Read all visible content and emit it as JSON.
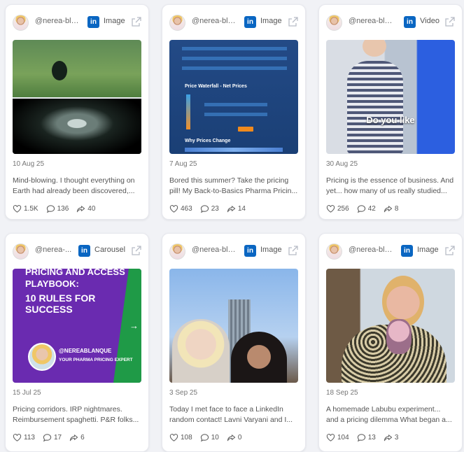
{
  "posts": [
    {
      "handle": "@nerea-bla...",
      "network": "in",
      "type": "Image",
      "date": "10 Aug 25",
      "desc1": "Mind-blowing. I thought everything on",
      "desc2": "Earth had already been discovered,...",
      "likes": "1.5K",
      "comments": "136",
      "shares": "40"
    },
    {
      "handle": "@nerea-bla...",
      "network": "in",
      "type": "Image",
      "date": "7 Aug 25",
      "desc1": "Bored this summer? Take the pricing",
      "desc2": "pill! My Back-to-Basics Pharma Pricin...",
      "likes": "463",
      "comments": "23",
      "shares": "14",
      "media_text": [
        "Price Waterfall - Net Prices",
        "Why Prices Change"
      ]
    },
    {
      "handle": "@nerea-bla...",
      "network": "in",
      "type": "Video",
      "date": "30 Aug 25",
      "desc1": "Pricing is the essence of business. And",
      "desc2": "yet... how many of us really studied...",
      "likes": "256",
      "comments": "42",
      "shares": "8",
      "media_text": [
        "Do you like"
      ]
    },
    {
      "handle": "@nerea-...",
      "network": "in",
      "type": "Carousel",
      "date": "15 Jul 25",
      "desc1": "Pricing corridors. IRP nightmares.",
      "desc2": "Reimbursement spaghetti. P&R folks...",
      "likes": "113",
      "comments": "17",
      "shares": "6",
      "media_text": [
        "PRICING AND ACCESS",
        "PLAYBOOK:",
        "10 RULES FOR SUCCESS",
        "@NEREABLANQUE",
        "YOUR PHARMA PRICING EXPERT"
      ]
    },
    {
      "handle": "@nerea-bla...",
      "network": "in",
      "type": "Image",
      "date": "3 Sep 25",
      "desc1": "Today I met face to face a LinkedIn",
      "desc2": "random contact! Lavni Varyani and I...",
      "likes": "108",
      "comments": "10",
      "shares": "0"
    },
    {
      "handle": "@nerea-bla...",
      "network": "in",
      "type": "Image",
      "date": "18 Sep 25",
      "desc1": "A homemade Labubu experiment...",
      "desc2": "and a pricing dilemma What began a...",
      "likes": "104",
      "comments": "13",
      "shares": "3"
    }
  ],
  "icons": {
    "network": "linkedin-icon",
    "external": "external-link-icon",
    "likes": "heart-icon",
    "comments": "comment-icon",
    "shares": "share-icon"
  },
  "colors": {
    "linkedin": "#0a66c2",
    "page_bg": "#f1f2f6",
    "card_bg": "#ffffff"
  }
}
